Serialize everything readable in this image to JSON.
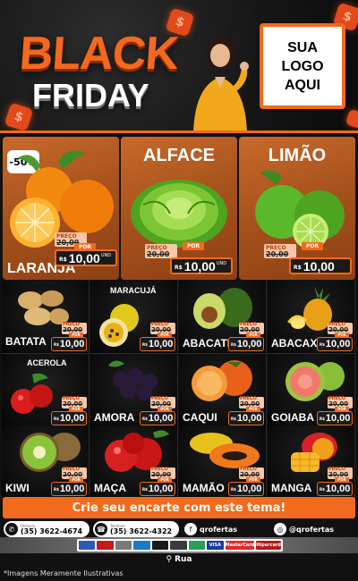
{
  "header": {
    "title_line1": "BLACK",
    "title_line2": "FRIDAY",
    "logo_line1": "SUA",
    "logo_line2": "LOGO",
    "logo_line3": "AQUI",
    "coin_symbol": "$"
  },
  "labels": {
    "preco": "PREÇO",
    "por": "POR",
    "currency": "R$",
    "unit": "UND"
  },
  "top_products": [
    {
      "name": "LARANJA",
      "badge": "-50%",
      "old_price": "20,00",
      "price": "10,00"
    },
    {
      "name": "ALFACE",
      "old_price": "20,00",
      "price": "10,00"
    },
    {
      "name": "LIMÃO",
      "old_price": "20,00",
      "price": "10,00"
    }
  ],
  "grid_products": [
    {
      "name": "BATATA",
      "old_price": "20,00",
      "price": "10,00"
    },
    {
      "name": "MARACUJÁ",
      "old_price": "20,00",
      "price": "10,00"
    },
    {
      "name": "ABACATE",
      "old_price": "20,00",
      "price": "10,00"
    },
    {
      "name": "ABACAXI",
      "old_price": "20,00",
      "price": "10,00"
    },
    {
      "name": "ACEROLA",
      "old_price": "20,00",
      "price": "10,00"
    },
    {
      "name": "AMORA",
      "old_price": "20,00",
      "price": "10,00"
    },
    {
      "name": "CAQUI",
      "old_price": "20,00",
      "price": "10,00"
    },
    {
      "name": "GOIABA",
      "old_price": "20,00",
      "price": "10,00"
    },
    {
      "name": "KIWI",
      "old_price": "20,00",
      "price": "10,00"
    },
    {
      "name": "MAÇA",
      "old_price": "20,00",
      "price": "10,00"
    },
    {
      "name": "MAMÃO",
      "old_price": "20,00",
      "price": "10,00"
    },
    {
      "name": "MANGA",
      "old_price": "20,00",
      "price": "10,00"
    }
  ],
  "footer": {
    "cta": "Crie seu encarte com este tema!",
    "contacts": [
      {
        "icon": "whatsapp-icon",
        "small": "Delivery",
        "text": "(35) 3622-4674"
      },
      {
        "icon": "phone-icon",
        "small": "Telefone",
        "text": "(35) 3622-4322"
      },
      {
        "icon": "facebook-icon",
        "small": "",
        "text": "qrofertas"
      },
      {
        "icon": "instagram-icon",
        "small": "",
        "text": "@qrofertas"
      }
    ],
    "payments": [
      "VISA",
      "MasterCard",
      "Hipercard"
    ],
    "address": "Rua",
    "disclaimer": "*Imagens Meramente Ilustrativas"
  },
  "colors": {
    "accent": "#f26a1b",
    "background": "#111111",
    "card": "#a5511c"
  }
}
